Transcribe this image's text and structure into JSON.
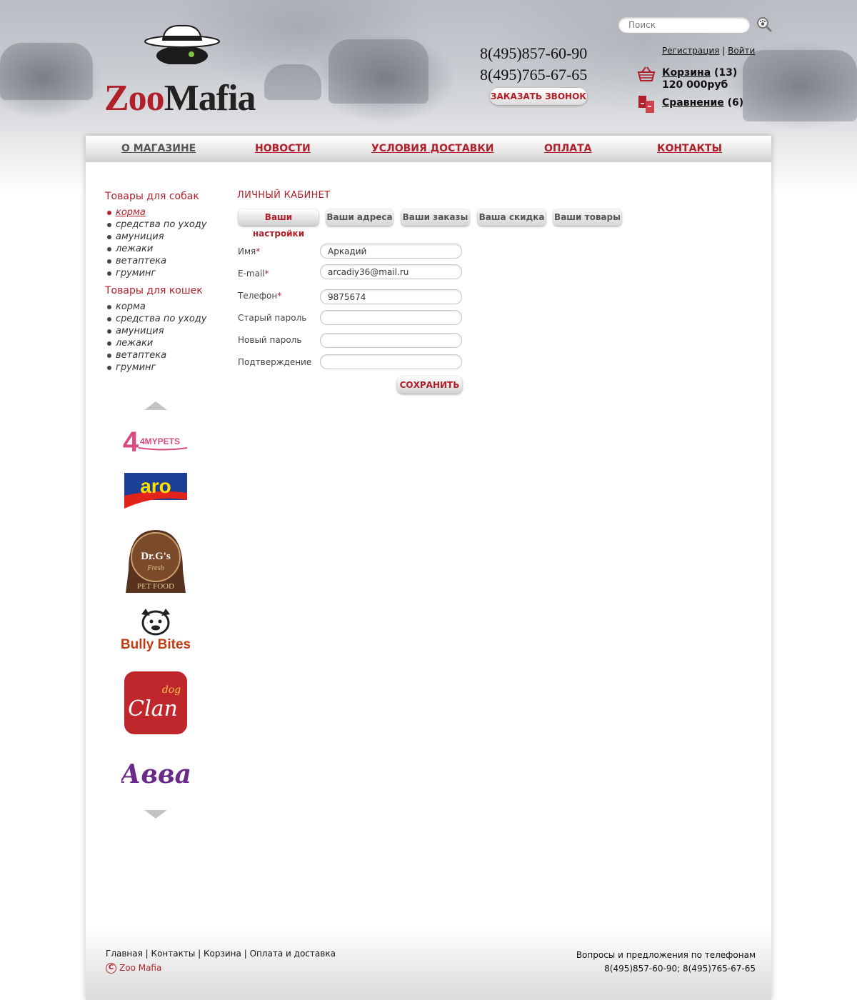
{
  "header": {
    "logo_text_zoo": "Zoo",
    "logo_text_mafia": "Mafia",
    "phones": [
      "8(495)857-60-90",
      "8(495)765-67-65"
    ],
    "callback_label": "ЗАКАЗАТЬ ЗВОНОК",
    "search_placeholder": "Поиск",
    "register_label": "Регистрация",
    "separator": "|",
    "login_label": "Войти",
    "cart_label": "Корзина",
    "cart_count": "(13)",
    "cart_sum": "120 000руб",
    "compare_label": "Сравнение",
    "compare_count": "(6)"
  },
  "nav": {
    "items": [
      {
        "label": "О МАГАЗИНЕ",
        "active": true
      },
      {
        "label": "НОВОСТИ"
      },
      {
        "label": "УСЛОВИЯ ДОСТАВКИ"
      },
      {
        "label": "ОПЛАТА"
      },
      {
        "label": "КОНТАКТЫ"
      }
    ]
  },
  "sidebar": {
    "dogs_title": "Товары для собак",
    "dogs_items": [
      "корма",
      "средства по уходу",
      "амуниция",
      "лежаки",
      "ветаптека",
      "груминг"
    ],
    "cats_title": "Товары для кошек",
    "cats_items": [
      "корма",
      "средства по уходу",
      "амуниция",
      "лежаки",
      "ветаптека",
      "груминг"
    ],
    "brands": [
      {
        "name": "4MYPETS",
        "icon": "4mypets-logo"
      },
      {
        "name": "aro",
        "icon": "aro-logo"
      },
      {
        "name": "Dr.G's",
        "sub": "Fresh",
        "extra": "PET FOOD",
        "icon": "drgs-logo"
      },
      {
        "name": "Bully Bites",
        "icon": "bully-bites-logo"
      },
      {
        "name": "Clan",
        "sub": "dog",
        "icon": "dog-clan-logo"
      },
      {
        "name": "Авва",
        "icon": "avva-logo"
      }
    ]
  },
  "account": {
    "title": "ЛИЧНЫЙ КАБИНЕТ",
    "tabs": [
      "Ваши настройки",
      "Ваши адреса",
      "Ваши заказы",
      "Ваша скидка",
      "Ваши товары"
    ],
    "fields": [
      {
        "label": "Имя",
        "required": true,
        "value": "Аркадий"
      },
      {
        "label": "E-mail",
        "required": true,
        "value": "arcadiy36@mail.ru"
      },
      {
        "label": "Телефон",
        "required": true,
        "value": "9875674"
      },
      {
        "label": "Старый пароль",
        "required": false,
        "value": ""
      },
      {
        "label": "Новый пароль",
        "required": false,
        "value": ""
      },
      {
        "label": "Подтверждение",
        "required": false,
        "value": ""
      }
    ],
    "required_mark": "*",
    "save_label": "СОХРАНИТЬ"
  },
  "footer": {
    "links": [
      "Главная",
      "Контакты",
      "Корзина",
      "Оплата и доставка"
    ],
    "copyright_symbol": "C",
    "copyright": "Zoo Mafia",
    "contact_title": "Вопросы и предложения по телефонам",
    "contact_phones": "8(495)857-60-90; 8(495)765-67-65"
  },
  "colors": {
    "accent": "#b0202a",
    "text": "#333333"
  }
}
